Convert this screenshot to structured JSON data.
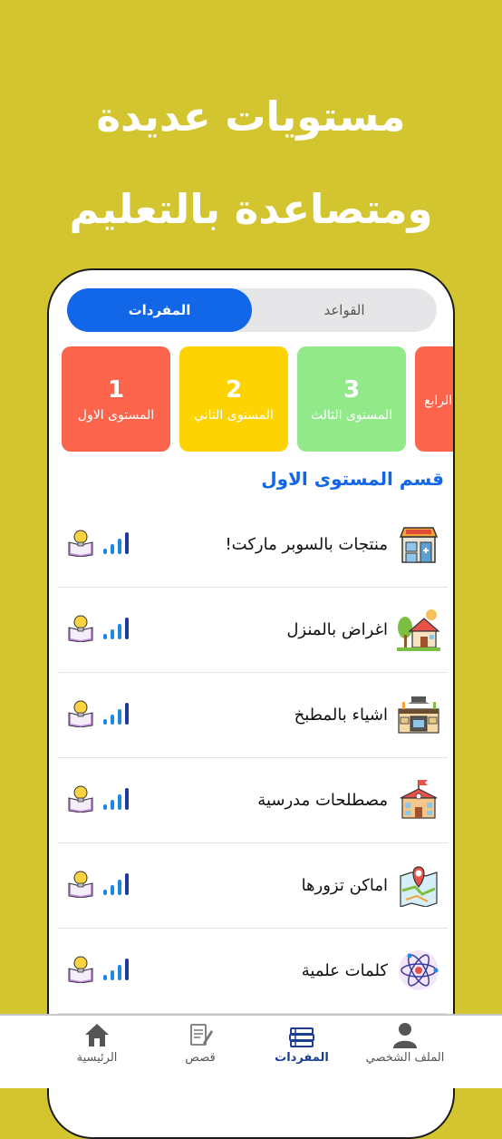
{
  "headline": {
    "line1": "مستويات عديدة",
    "line2": "ومتصاعدة بالتعليم"
  },
  "colors": {
    "background": "#D3C530",
    "accent": "#1167E8",
    "level1": "#FC644C",
    "level2": "#FDD303",
    "level3": "#92E98A",
    "level4": "#FC644C"
  },
  "segment": {
    "vocab": "المفردات",
    "grammar": "القواعد",
    "selected": "vocab"
  },
  "levels": [
    {
      "num": "1",
      "label": "المستوى الاول"
    },
    {
      "num": "2",
      "label": "المستوى الثاني"
    },
    {
      "num": "3",
      "label": "المستوى الثالث"
    },
    {
      "num": "",
      "label": "الرابع"
    }
  ],
  "section_title": "قسم المستوى الاول",
  "items": [
    {
      "title": "منتجات بالسوبر ماركت!",
      "icon": "supermarket-icon"
    },
    {
      "title": "اغراض بالمنزل",
      "icon": "house-icon"
    },
    {
      "title": "اشياء بالمطبخ",
      "icon": "kitchen-icon"
    },
    {
      "title": "مصطلحات مدرسية",
      "icon": "school-icon"
    },
    {
      "title": "اماكن تزورها",
      "icon": "map-pin-icon"
    },
    {
      "title": "كلمات علمية",
      "icon": "atom-icon"
    }
  ],
  "nav": {
    "profile": "الملف الشخصي",
    "vocab": "المفردات",
    "stories": "قصص",
    "home": "الرئيسية",
    "active": "vocab"
  }
}
